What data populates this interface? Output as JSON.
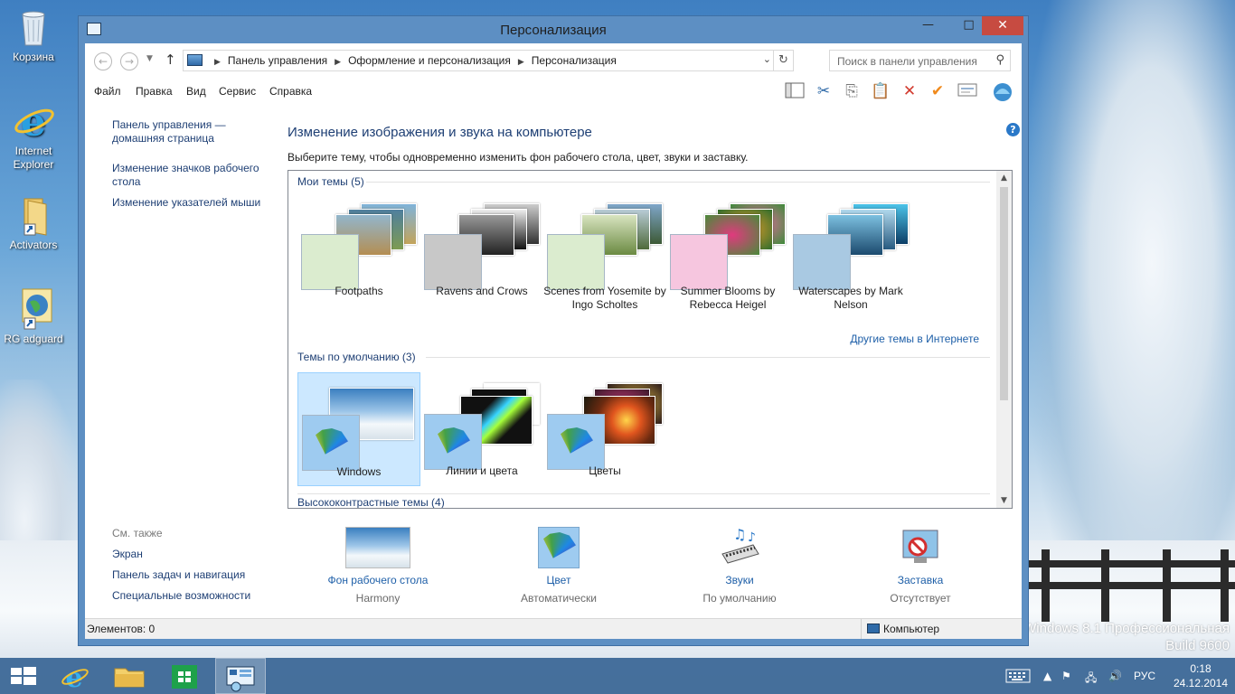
{
  "desktop": {
    "icons": [
      {
        "label": "Корзина"
      },
      {
        "label": "Internet Explorer"
      },
      {
        "label": "Activators"
      },
      {
        "label": "RG adguard"
      }
    ],
    "brand_line1": "Windows 8.1 Профессиональная",
    "brand_line2": "Build 9600"
  },
  "window": {
    "title": "Персонализация",
    "minimize_glyph": "—",
    "maximize_glyph": "□",
    "close_glyph": "✕",
    "breadcrumbs": [
      "Панель управления",
      "Оформление и персонализация",
      "Персонализация"
    ],
    "search_placeholder": "Поиск в панели управления",
    "menu": [
      "Файл",
      "Правка",
      "Вид",
      "Сервис",
      "Справка"
    ]
  },
  "sidebar": {
    "links": [
      {
        "label": "Панель управления — домашняя страница"
      },
      {
        "label": "Изменение значков рабочего стола"
      },
      {
        "label": "Изменение указателей мыши"
      }
    ],
    "see_also_title": "См. также",
    "see_also": [
      {
        "label": "Экран"
      },
      {
        "label": "Панель задач и навигация"
      },
      {
        "label": "Специальные возможности"
      }
    ]
  },
  "main": {
    "title": "Изменение изображения и звука на компьютере",
    "description": "Выберите тему, чтобы одновременно изменить фон рабочего стола, цвет, звуки и заставку.",
    "my_themes_header": "Мои темы (5)",
    "my_themes": [
      {
        "name": "Footpaths"
      },
      {
        "name": "Ravens and Crows"
      },
      {
        "name": "Scenes from Yosemite by Ingo Scholtes"
      },
      {
        "name": "Summer Blooms by Rebecca Heigel"
      },
      {
        "name": "Waterscapes by Mark Nelson"
      }
    ],
    "more_themes_link": "Другие темы в Интернете",
    "default_themes_header": "Темы по умолчанию (3)",
    "default_themes": [
      {
        "name": "Windows",
        "selected": true
      },
      {
        "name": "Линии и цвета",
        "selected": false
      },
      {
        "name": "Цветы",
        "selected": false
      }
    ],
    "high_contrast_header": "Высококонтрастные темы (4)"
  },
  "bottom": [
    {
      "title": "Фон рабочего стола",
      "subtitle": "Harmony",
      "icon": "desktop-background-icon"
    },
    {
      "title": "Цвет",
      "subtitle": "Автоматически",
      "icon": "color-icon"
    },
    {
      "title": "Звуки",
      "subtitle": "По умолчанию",
      "icon": "sounds-icon"
    },
    {
      "title": "Заставка",
      "subtitle": "Отсутствует",
      "icon": "screensaver-icon"
    }
  ],
  "statusbar": {
    "items": "Элементов: 0",
    "zone": "Компьютер"
  },
  "taskbar": {
    "lang": "РУС",
    "time": "0:18",
    "date": "24.12.2014"
  }
}
